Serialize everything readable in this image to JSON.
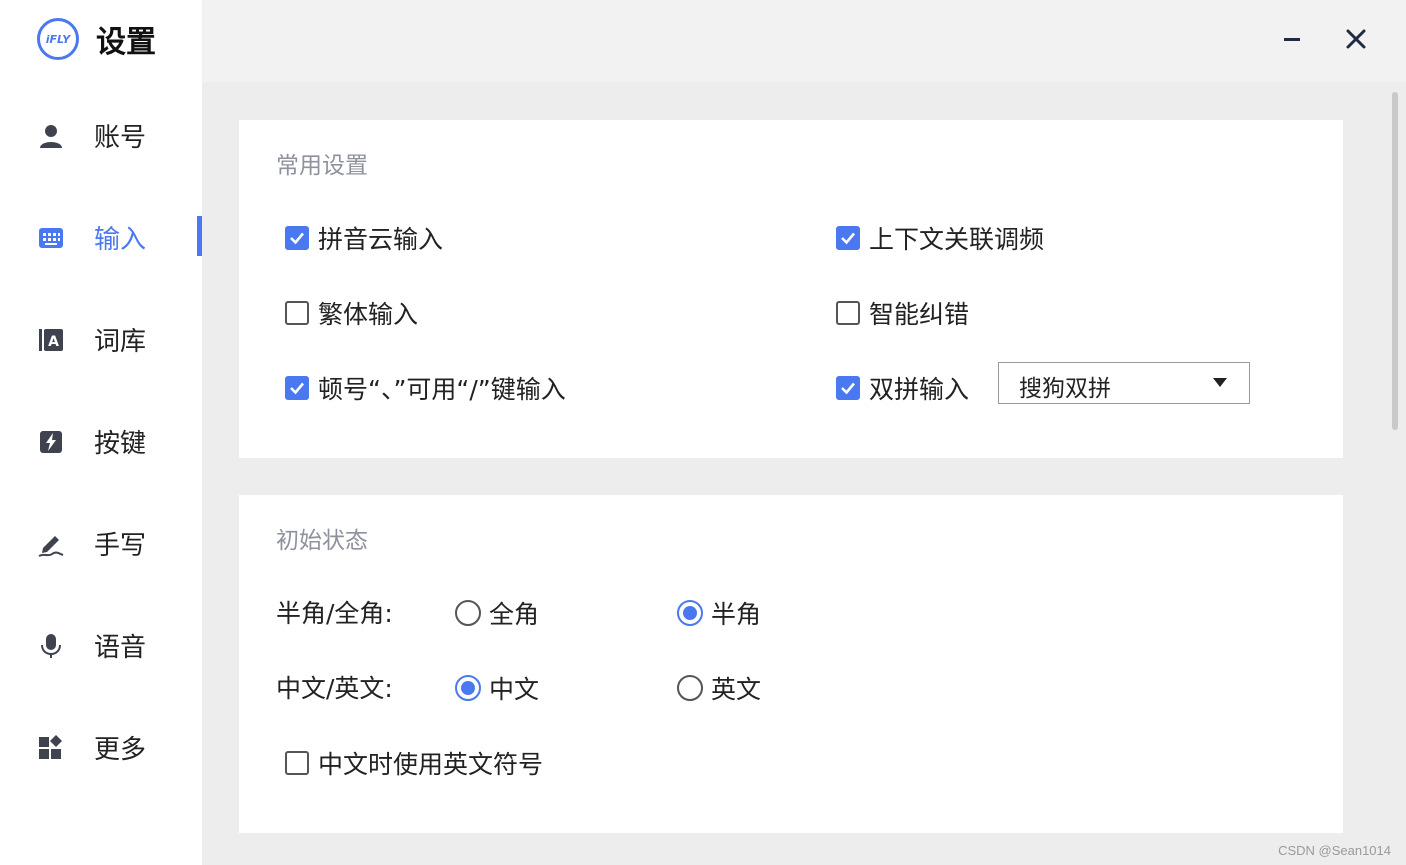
{
  "app": {
    "logo_text": "iFLY",
    "title": "设置"
  },
  "sidebar": {
    "items": [
      {
        "label": "账号",
        "icon": "user-icon"
      },
      {
        "label": "输入",
        "icon": "keyboard-icon",
        "active": true
      },
      {
        "label": "词库",
        "icon": "dictionary-icon"
      },
      {
        "label": "按键",
        "icon": "key-bolt-icon"
      },
      {
        "label": "手写",
        "icon": "pen-icon"
      },
      {
        "label": "语音",
        "icon": "microphone-icon"
      },
      {
        "label": "更多",
        "icon": "apps-icon"
      }
    ]
  },
  "window": {
    "minimize_icon": "minimize-icon",
    "close_icon": "close-icon"
  },
  "common": {
    "title": "常用设置",
    "options": [
      {
        "label": "拼音云输入",
        "checked": true
      },
      {
        "label": "上下文关联调频",
        "checked": true
      },
      {
        "label": "繁体输入",
        "checked": false
      },
      {
        "label": "智能纠错",
        "checked": false
      },
      {
        "label": "顿号“、”可用“/”键输入",
        "checked": true
      },
      {
        "label": "双拼输入",
        "checked": true
      }
    ],
    "shuangpin_select": {
      "value": "搜狗双拼"
    }
  },
  "initial": {
    "title": "初始状态",
    "width_label": "半角/全角:",
    "width_options": [
      {
        "label": "全角",
        "selected": false
      },
      {
        "label": "半角",
        "selected": true
      }
    ],
    "lang_label": "中文/英文:",
    "lang_options": [
      {
        "label": "中文",
        "selected": true
      },
      {
        "label": "英文",
        "selected": false
      }
    ],
    "english_punct": {
      "label": "中文时使用英文符号",
      "checked": false
    }
  },
  "colors": {
    "accent": "#4a78f0",
    "sidebar_bg": "#ffffff",
    "content_bg": "#ededed"
  },
  "watermark": "CSDN @Sean1014"
}
